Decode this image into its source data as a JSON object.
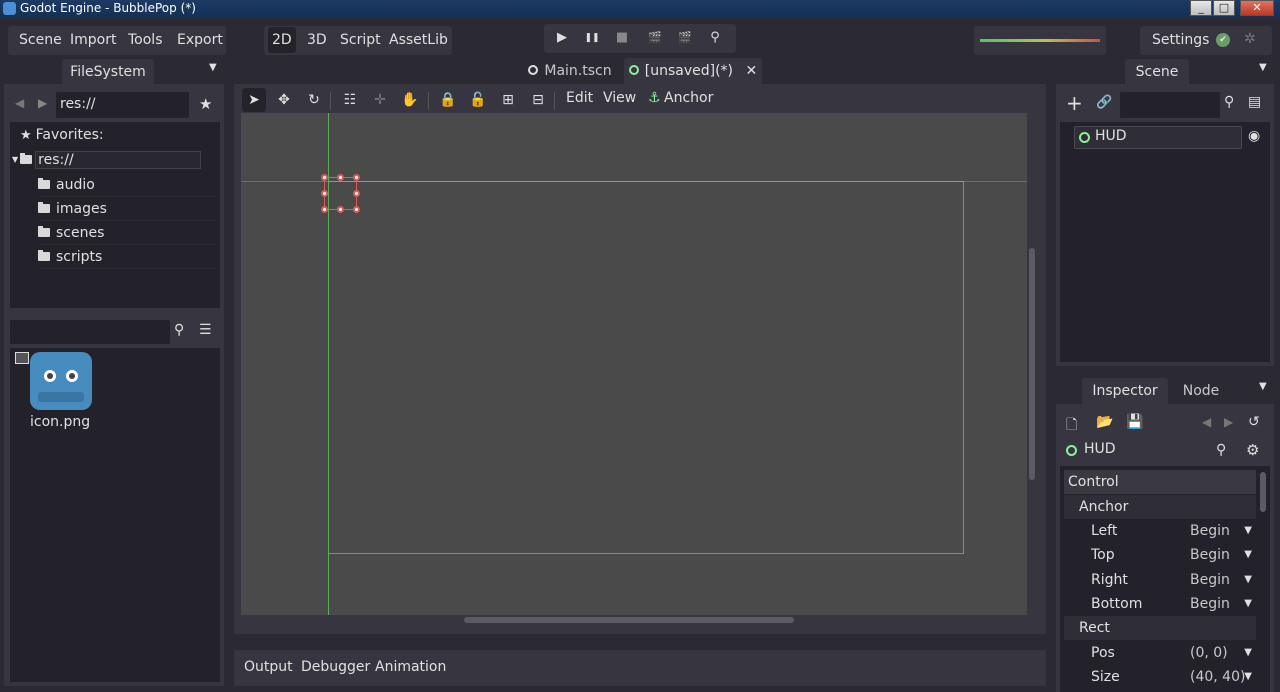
{
  "window": {
    "title": "Godot Engine - BubblePop (*)",
    "min": "_",
    "max": "□",
    "close": "✕"
  },
  "menu": {
    "scene": "Scene",
    "import": "Import",
    "tools": "Tools",
    "export": "Export"
  },
  "modes": {
    "m2d": "2D",
    "m3d": "3D",
    "script": "Script",
    "assetlib": "AssetLib"
  },
  "play": {
    "play": "▶",
    "pause": "❚❚",
    "stop": "■",
    "scene_play": "🎬",
    "custom_play": "🎬",
    "remote": "⚲"
  },
  "settings": {
    "label": "Settings",
    "status_ok": "✔",
    "spinner": "✲"
  },
  "filesystem": {
    "tab": "FileSystem",
    "back": "◀",
    "forward": "▶",
    "path": "res://",
    "favorites": "Favorites:",
    "root": "res://",
    "folders": [
      "audio",
      "images",
      "scenes",
      "scripts"
    ],
    "search_placeholder": "",
    "files": [
      {
        "name": "icon.png"
      }
    ]
  },
  "scene_tabs": [
    {
      "label": "Main.tscn"
    },
    {
      "label": "[unsaved](*)"
    }
  ],
  "toolbar": {
    "edit": "Edit",
    "view": "View",
    "anchor": "Anchor"
  },
  "bottom": {
    "output": "Output",
    "debugger": "Debugger",
    "animation": "Animation"
  },
  "scene_dock": {
    "tab": "Scene",
    "add": "+",
    "link": "🔗",
    "filter_placeholder": "",
    "root_node": "HUD"
  },
  "inspector": {
    "tab_inspector": "Inspector",
    "tab_node": "Node",
    "node_name": "HUD",
    "sections": {
      "control": "Control",
      "anchor": "Anchor",
      "rect": "Rect"
    },
    "anchor_props": [
      {
        "name": "Left",
        "value": "Begin"
      },
      {
        "name": "Top",
        "value": "Begin"
      },
      {
        "name": "Right",
        "value": "Begin"
      },
      {
        "name": "Bottom",
        "value": "Begin"
      }
    ],
    "rect_props": [
      {
        "name": "Pos",
        "value": "(0, 0)"
      },
      {
        "name": "Size",
        "value": "(40, 40)"
      }
    ]
  },
  "colors": {
    "accent": "#4d8ac9",
    "node_ring": "#8eef97",
    "guide_red": "#d14d4d",
    "guide_green": "#63c55f",
    "viewport_frame": "#7f7fd0"
  }
}
